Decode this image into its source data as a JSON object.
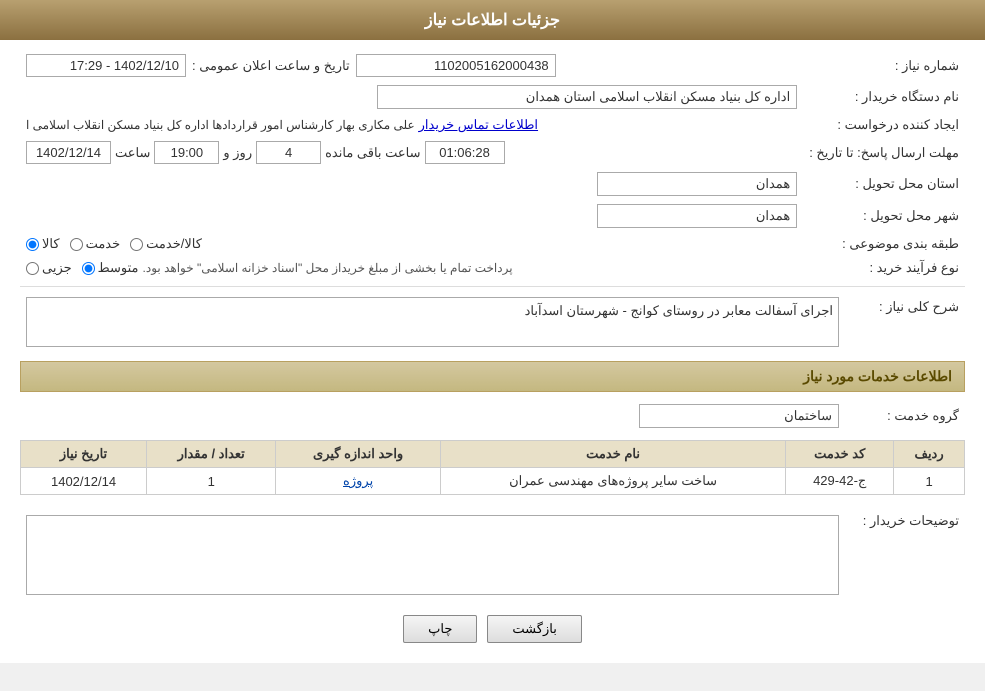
{
  "header": {
    "title": "جزئیات اطلاعات نیاز"
  },
  "fields": {
    "request_number_label": "شماره نیاز :",
    "request_number_value": "1102005162000438",
    "buyer_org_label": "نام دستگاه خریدار :",
    "buyer_org_value": "اداره کل بنیاد مسکن انقلاب اسلامی استان همدان",
    "requester_label": "ایجاد کننده درخواست :",
    "requester_value": "علی مکاری بهار کارشناس امور قراردادها اداره کل بنیاد مسکن انقلاب اسلامی ا",
    "requester_link": "اطلاعات تماس خریدار",
    "deadline_label": "مهلت ارسال پاسخ: تا تاریخ :",
    "deadline_date": "1402/12/14",
    "deadline_time_label": "ساعت",
    "deadline_time": "19:00",
    "deadline_days_label": "روز و",
    "deadline_days": "4",
    "deadline_remaining_label": "ساعت باقی مانده",
    "deadline_remaining": "01:06:28",
    "province_label": "استان محل تحویل :",
    "province_value": "همدان",
    "city_label": "شهر محل تحویل :",
    "city_value": "همدان",
    "category_label": "طبقه بندی موضوعی :",
    "category_options": [
      "کالا",
      "خدمت",
      "کالا/خدمت"
    ],
    "category_selected": "کالا",
    "process_label": "نوع فرآیند خرید :",
    "process_options": [
      "جزیی",
      "متوسط"
    ],
    "process_selected": "متوسط",
    "process_note": "پرداخت تمام یا بخشی از مبلغ خریداز محل \"اسناد خزانه اسلامی\" خواهد بود.",
    "announcement_label": "تاریخ و ساعت اعلان عمومی :",
    "announcement_value": "1402/12/10 - 17:29"
  },
  "description_section": {
    "title": "شرح کلی نیاز :",
    "value": "اجرای آسفالت معابر در روستای کوانج - شهرستان اسدآباد"
  },
  "services_section": {
    "title": "اطلاعات خدمات مورد نیاز",
    "service_group_label": "گروه خدمت :",
    "service_group_value": "ساختمان",
    "table_headers": [
      "ردیف",
      "کد خدمت",
      "نام خدمت",
      "واحد اندازه گیری",
      "تعداد / مقدار",
      "تاریخ نیاز"
    ],
    "table_rows": [
      {
        "row": "1",
        "code": "ج-42-429",
        "name": "ساخت سایر پروژه‌های مهندسی عمران",
        "unit": "پروژه",
        "count": "1",
        "date": "1402/12/14"
      }
    ]
  },
  "buyer_notes_label": "توضیحات خریدار :",
  "buyer_notes_value": "",
  "buttons": {
    "print": "چاپ",
    "back": "بازگشت"
  }
}
